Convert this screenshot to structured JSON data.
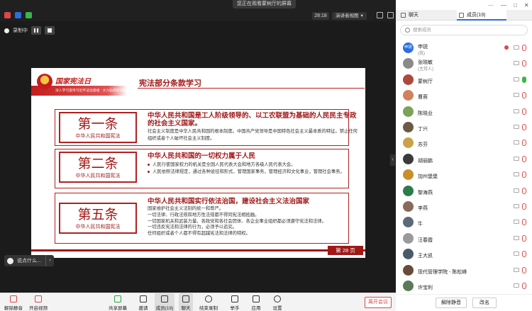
{
  "screen_share_title": "您正在观看蒙树厅的屏幕",
  "timer": "28:18",
  "view_mode": "演讲者视图",
  "recording": {
    "label": "录制中"
  },
  "slide": {
    "logo_text": "国家宪法日",
    "tagline": "深入学习宣传习近平法治思想 · 大力弘扬宪法精神",
    "title": "宪法部分条款学习",
    "page_label": "第 28 页",
    "articles": [
      {
        "title": "第一条",
        "sub": "中华人民共和国宪法",
        "heading": "中华人民共和国是工人阶级领导的、以工农联盟为基础的人民民主专政的社会主义国家。",
        "lines": [
          "社会主义制度是中华人民共和国的根本制度。中国共产党领导是中国特色社会主义最本质的特征。禁止任何组织或者个人破坏社会主义制度。"
        ]
      },
      {
        "title": "第二条",
        "sub": "中华人民共和国宪法",
        "heading": "中华人民共和国的一切权力属于人民",
        "lines": [
          "人民行使国家权力的机关是全国人民代表大会和地方各级人民代表大会。",
          "人民依照法律规定，通过各种途径和形式，管理国家事务，管理经济和文化事业，管理社会事务。"
        ]
      },
      {
        "title": "第五条",
        "sub": "中华人民共和国宪法",
        "heading": "中华人民共和国实行依法治国，建设社会主义法治国家",
        "lines": [
          "国家维护社会主义法制的统一和尊严。",
          "一切法律、行政法规和地方性法规都不得同宪法相抵触。",
          "一切国家机关和武装力量、各政党和各社会团体、各企业事业组织都必须遵守宪法和法律。",
          "一切违反宪法和法律的行为，必须予以追究。",
          "任何组织或者个人都不得有超越宪法和法律的特权。"
        ]
      }
    ]
  },
  "chat_preview": "说点什么...",
  "toolbar": {
    "mute": "解除静音",
    "video": "开启视频",
    "share": "共享屏幕",
    "invite": "邀请",
    "members": "成员(19)",
    "chat": "聊天",
    "end_record": "结束录制",
    "raise": "举手",
    "apps": "应用",
    "settings": "设置",
    "leave": "离开会议"
  },
  "panel": {
    "tab_chat": "聊天",
    "tab_members": "成员(19)",
    "search_placeholder": "搜索成员",
    "members": [
      {
        "name": "申锐",
        "role": "(我)",
        "avatar": "申锐",
        "color": "#2a6ee0",
        "mic_on": false,
        "rec": true
      },
      {
        "name": "张晓敏",
        "role": "(主持人)",
        "avatar": "",
        "color": "#8a8a8a",
        "mic_on": false,
        "rec": false
      },
      {
        "name": "蒙树厅",
        "role": "",
        "avatar": "",
        "color": "#b0473c",
        "mic_on": true,
        "rec": false
      },
      {
        "name": "曹蓉",
        "role": "",
        "avatar": "",
        "color": "#d0825a",
        "mic_on": false,
        "rec": false
      },
      {
        "name": "陈晓业",
        "role": "",
        "avatar": "",
        "color": "#7aa35a",
        "mic_on": false,
        "rec": false
      },
      {
        "name": "丁兴",
        "role": "",
        "avatar": "",
        "color": "#6b5a44",
        "mic_on": false,
        "rec": false
      },
      {
        "name": "苏芬",
        "role": "",
        "avatar": "",
        "color": "#c9a24a",
        "mic_on": false,
        "rec": false
      },
      {
        "name": "胡丽鹏",
        "role": "",
        "avatar": "",
        "color": "#3a3a3a",
        "mic_on": false,
        "rec": false
      },
      {
        "name": "加州堡堡",
        "role": "",
        "avatar": "",
        "color": "#c88f2a",
        "mic_on": false,
        "rec": false
      },
      {
        "name": "黎海燕",
        "role": "",
        "avatar": "",
        "color": "#2d7a4a",
        "mic_on": false,
        "rec": false
      },
      {
        "name": "李燕",
        "role": "",
        "avatar": "",
        "color": "#8a6a5a",
        "mic_on": false,
        "rec": false
      },
      {
        "name": "牛",
        "role": "",
        "avatar": "",
        "color": "#5a6a7a",
        "mic_on": false,
        "rec": false
      },
      {
        "name": "汪春霞",
        "role": "",
        "avatar": "",
        "color": "#9a9a9a",
        "mic_on": false,
        "rec": false
      },
      {
        "name": "王大凯",
        "role": "",
        "avatar": "",
        "color": "#4a5a6a",
        "mic_on": false,
        "rec": false
      },
      {
        "name": "现代管理学院 - 陈松峰",
        "role": "",
        "avatar": "",
        "color": "#6a4a3a",
        "mic_on": false,
        "rec": false
      },
      {
        "name": "许宝利",
        "role": "",
        "avatar": "",
        "color": "#5a7a5a",
        "mic_on": false,
        "rec": false
      }
    ],
    "mute_all": "解除静音",
    "rename": "改名"
  }
}
